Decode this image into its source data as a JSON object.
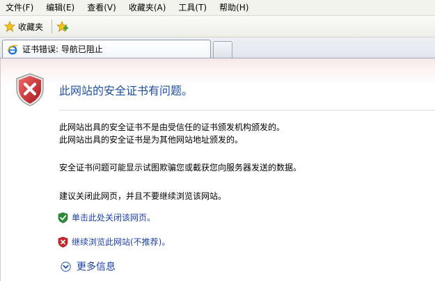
{
  "menu": [
    "文件(F)",
    "编辑(E)",
    "查看(V)",
    "收藏夹(A)",
    "工具(T)",
    "帮助(H)"
  ],
  "favorites_bar": {
    "favorites_label": "收藏夹"
  },
  "tab": {
    "title": "证书错误: 导航已阻止"
  },
  "page": {
    "headline": "此网站的安全证书有问题。",
    "paragraphs": [
      "此网站出具的安全证书不是由受信任的证书颁发机构颁发的。",
      "此网站出具的安全证书是为其他网站地址颁发的。",
      "安全证书问题可能显示试图欺骗您或截获您向服务器发送的数据。",
      "建议关闭此网页，并且不要继续浏览该网站。"
    ],
    "close_link": "单击此处关闭该网页。",
    "continue_link": "继续浏览此网站(不推荐)。",
    "more_info": "更多信息"
  },
  "icons": {
    "error_shield": "shield-error-icon",
    "ok_shield": "shield-check-icon",
    "warning_shield": "shield-x-icon",
    "more_info": "chevron-down-circle-icon",
    "favorites": "star-icon",
    "add_favorite": "add-favorite-icon",
    "tab_site": "ie-icon"
  },
  "colors": {
    "headline": "#1f4fa0",
    "link": "#1c3fa8",
    "error": "#c8282c",
    "ok": "#2e8b3a"
  }
}
